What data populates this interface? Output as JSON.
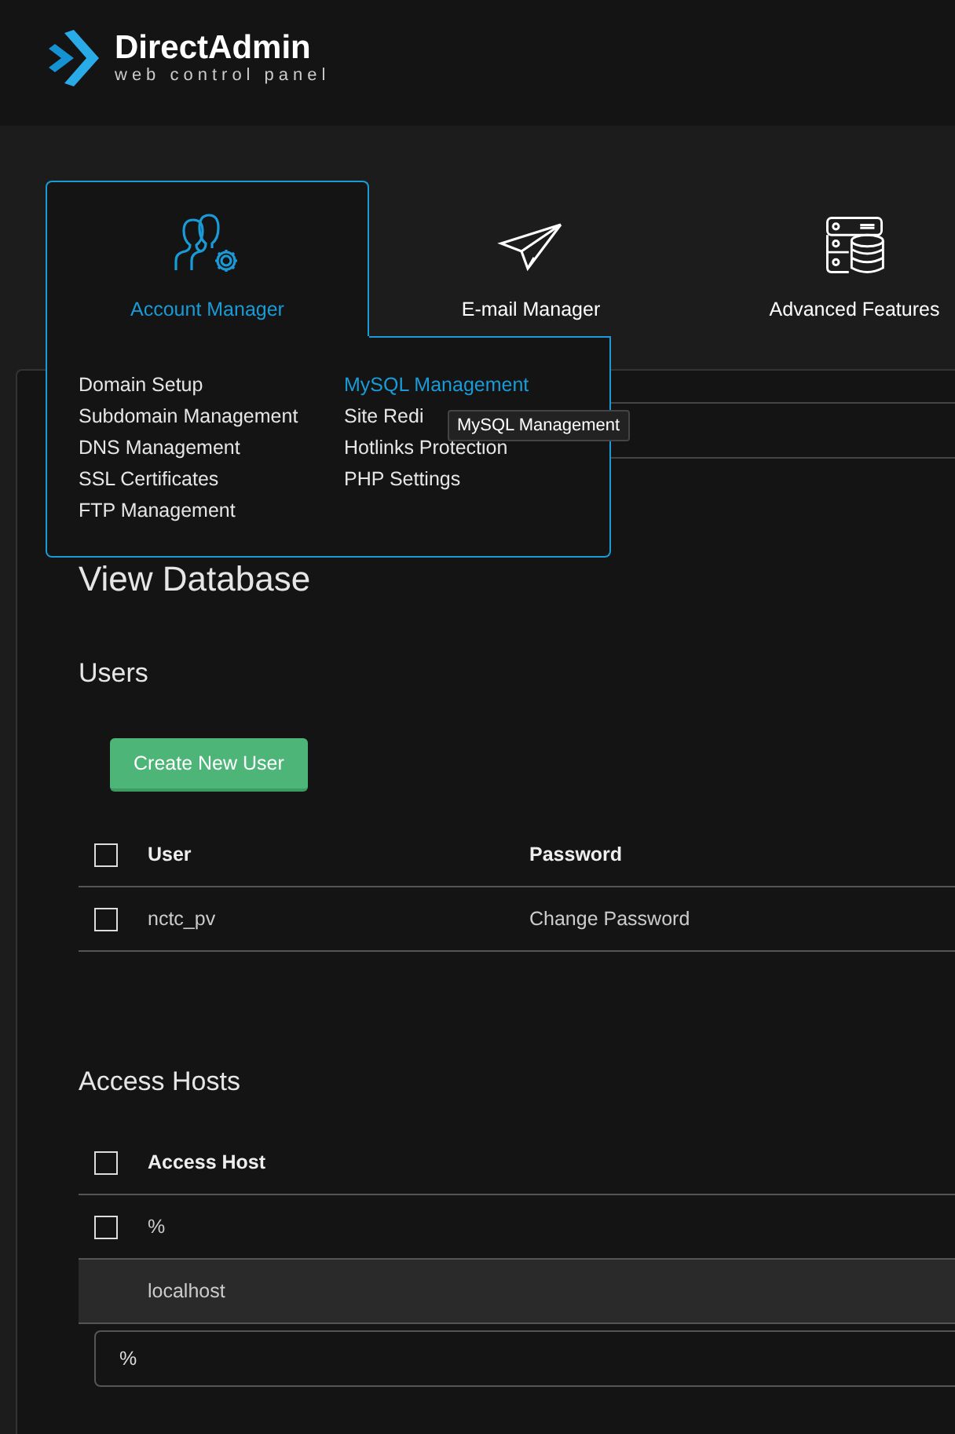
{
  "header": {
    "brand": "DirectAdmin",
    "tagline": "web control panel"
  },
  "nav": [
    {
      "label": "Account Manager",
      "selected": true
    },
    {
      "label": "E-mail Manager",
      "selected": false
    },
    {
      "label": "Advanced Features",
      "selected": false
    }
  ],
  "dropdown": {
    "columns": [
      [
        {
          "label": "Domain Setup",
          "highlighted": false
        },
        {
          "label": "Subdomain Management",
          "highlighted": false
        },
        {
          "label": "DNS Management",
          "highlighted": false
        },
        {
          "label": "SSL Certificates",
          "highlighted": false
        },
        {
          "label": "FTP Management",
          "highlighted": false
        }
      ],
      [
        {
          "label": "MySQL Management",
          "highlighted": true
        },
        {
          "label": "Site Redi",
          "highlighted": false
        },
        {
          "label": "Hotlinks Protection",
          "highlighted": false
        },
        {
          "label": "PHP Settings",
          "highlighted": false
        }
      ]
    ]
  },
  "tooltip": "MySQL Management",
  "page_title": "View Database",
  "users": {
    "title": "Users",
    "button": "Create New User",
    "columns": [
      "User",
      "Password"
    ],
    "header_checked": false,
    "rows": [
      {
        "checked": false,
        "cells": [
          "nctc_pv",
          "Change Password"
        ]
      }
    ]
  },
  "hosts": {
    "title": "Access Hosts",
    "columns": [
      "Access Host"
    ],
    "header_checked": false,
    "rows": [
      {
        "kind": "checkbox",
        "checked": false,
        "cells": [
          "%"
        ]
      },
      {
        "kind": "plain",
        "cells": [
          "localhost"
        ]
      }
    ],
    "new_host": {
      "value": "%"
    }
  }
}
